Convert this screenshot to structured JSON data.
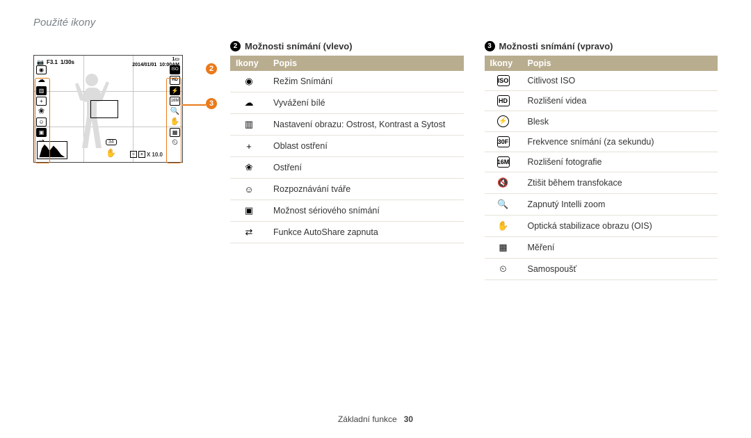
{
  "page_title": "Použité ikony",
  "footer": {
    "section": "Základní funkce",
    "page": "30"
  },
  "callouts": {
    "n2": "2",
    "n3": "3"
  },
  "lcd": {
    "aperture": "F3.1",
    "shutter": "1/30s",
    "date": "2014/01/01",
    "time": "10:00AM",
    "frames": "1",
    "burst_count": "34",
    "zoom": "X 10.0"
  },
  "left_table": {
    "heading_num": "2",
    "heading": "Možnosti snímání (vlevo)",
    "col_icon": "Ikony",
    "col_desc": "Popis",
    "rows": [
      {
        "icon": "camera-mode-icon",
        "glyph": "◉",
        "label": "Režim Snímání"
      },
      {
        "icon": "white-balance-icon",
        "glyph": "☁",
        "label": "Vyvážení bílé"
      },
      {
        "icon": "image-adjust-icon",
        "glyph": "▥",
        "label": "Nastavení obrazu: Ostrost, Kontrast a Sytost"
      },
      {
        "icon": "focus-area-icon",
        "glyph": "+",
        "label": "Oblast ostření"
      },
      {
        "icon": "macro-icon",
        "glyph": "❀",
        "label": "Ostření"
      },
      {
        "icon": "face-detect-icon",
        "glyph": "☺",
        "label": "Rozpoznávání tváře"
      },
      {
        "icon": "burst-icon",
        "glyph": "▣",
        "label": "Možnost sériového snímání"
      },
      {
        "icon": "autoshare-icon",
        "glyph": "⇄",
        "label": "Funkce AutoShare zapnuta"
      }
    ]
  },
  "right_table": {
    "heading_num": "3",
    "heading": "Možnosti snímání (vpravo)",
    "col_icon": "Ikony",
    "col_desc": "Popis",
    "rows": [
      {
        "icon": "iso-icon",
        "glyph": "ISO",
        "label": "Citlivost ISO"
      },
      {
        "icon": "video-res-icon",
        "glyph": "HD",
        "label": "Rozlišení videa"
      },
      {
        "icon": "flash-icon",
        "glyph": "⚡",
        "label": "Blesk"
      },
      {
        "icon": "fps-icon",
        "glyph": "30F",
        "label": "Frekvence snímání (za sekundu)"
      },
      {
        "icon": "photo-res-icon",
        "glyph": "16M",
        "label": "Rozlišení fotografie"
      },
      {
        "icon": "zoom-mute-icon",
        "glyph": "🔇",
        "label": "Ztišit během transfokace"
      },
      {
        "icon": "intelli-zoom-icon",
        "glyph": "🔍",
        "label": "Zapnutý Intelli zoom"
      },
      {
        "icon": "ois-icon",
        "glyph": "✋",
        "label": "Optická stabilizace obrazu (OIS)"
      },
      {
        "icon": "metering-icon",
        "glyph": "▦",
        "label": "Měření"
      },
      {
        "icon": "self-timer-icon",
        "glyph": "⏲",
        "label": "Samospoušť"
      }
    ]
  }
}
